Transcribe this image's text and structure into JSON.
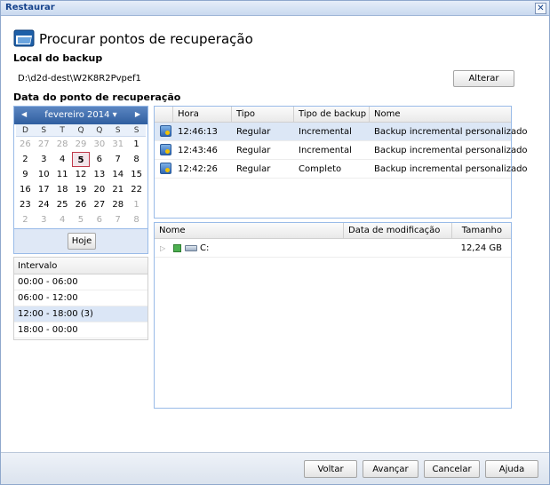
{
  "window": {
    "title": "Restaurar"
  },
  "header": {
    "title": "Procurar pontos de recuperação"
  },
  "backup_location": {
    "label": "Local do backup",
    "path": "D:\\d2d-dest\\W2K8R2Pvpef1",
    "change_label": "Alterar"
  },
  "recovery_date": {
    "label": "Data do ponto de recuperação"
  },
  "calendar": {
    "month_label": "fevereiro 2014",
    "dow": [
      "D",
      "S",
      "T",
      "Q",
      "Q",
      "S",
      "S"
    ],
    "days": [
      {
        "d": "26",
        "o": true
      },
      {
        "d": "27",
        "o": true
      },
      {
        "d": "28",
        "o": true
      },
      {
        "d": "29",
        "o": true
      },
      {
        "d": "30",
        "o": true
      },
      {
        "d": "31",
        "o": true
      },
      {
        "d": "1"
      },
      {
        "d": "2"
      },
      {
        "d": "3"
      },
      {
        "d": "4"
      },
      {
        "d": "5",
        "s": true
      },
      {
        "d": "6"
      },
      {
        "d": "7"
      },
      {
        "d": "8"
      },
      {
        "d": "9"
      },
      {
        "d": "10"
      },
      {
        "d": "11"
      },
      {
        "d": "12"
      },
      {
        "d": "13"
      },
      {
        "d": "14"
      },
      {
        "d": "15"
      },
      {
        "d": "16"
      },
      {
        "d": "17"
      },
      {
        "d": "18"
      },
      {
        "d": "19"
      },
      {
        "d": "20"
      },
      {
        "d": "21"
      },
      {
        "d": "22"
      },
      {
        "d": "23"
      },
      {
        "d": "24"
      },
      {
        "d": "25"
      },
      {
        "d": "26"
      },
      {
        "d": "27"
      },
      {
        "d": "28"
      },
      {
        "d": "1",
        "o": true
      },
      {
        "d": "2",
        "o": true
      },
      {
        "d": "3",
        "o": true
      },
      {
        "d": "4",
        "o": true
      },
      {
        "d": "5",
        "o": true
      },
      {
        "d": "6",
        "o": true
      },
      {
        "d": "7",
        "o": true
      },
      {
        "d": "8",
        "o": true
      }
    ],
    "today_label": "Hoje"
  },
  "interval": {
    "header": "Intervalo",
    "rows": [
      "00:00 - 06:00",
      "06:00 - 12:00",
      "12:00 - 18:00 (3)",
      "18:00 - 00:00"
    ],
    "selected_index": 2
  },
  "points_table": {
    "headers": {
      "time": "Hora",
      "type": "Tipo",
      "backup_type": "Tipo de backup",
      "name": "Nome"
    },
    "rows": [
      {
        "time": "12:46:13",
        "type": "Regular",
        "backup_type": "Incremental",
        "name": "Backup incremental personalizado",
        "selected": true
      },
      {
        "time": "12:43:46",
        "type": "Regular",
        "backup_type": "Incremental",
        "name": "Backup incremental personalizado"
      },
      {
        "time": "12:42:26",
        "type": "Regular",
        "backup_type": "Completo",
        "name": "Backup incremental personalizado"
      }
    ]
  },
  "files_table": {
    "headers": {
      "name": "Nome",
      "modified": "Data de modificação",
      "size": "Tamanho"
    },
    "rows": [
      {
        "name": "C:",
        "modified": "",
        "size": "12,24 GB"
      }
    ]
  },
  "footer": {
    "back": "Voltar",
    "next": "Avançar",
    "cancel": "Cancelar",
    "help": "Ajuda"
  },
  "colors": {
    "accent": "#15428b",
    "selection": "#dce7f6",
    "calendar_header": "#2f5e9f"
  }
}
